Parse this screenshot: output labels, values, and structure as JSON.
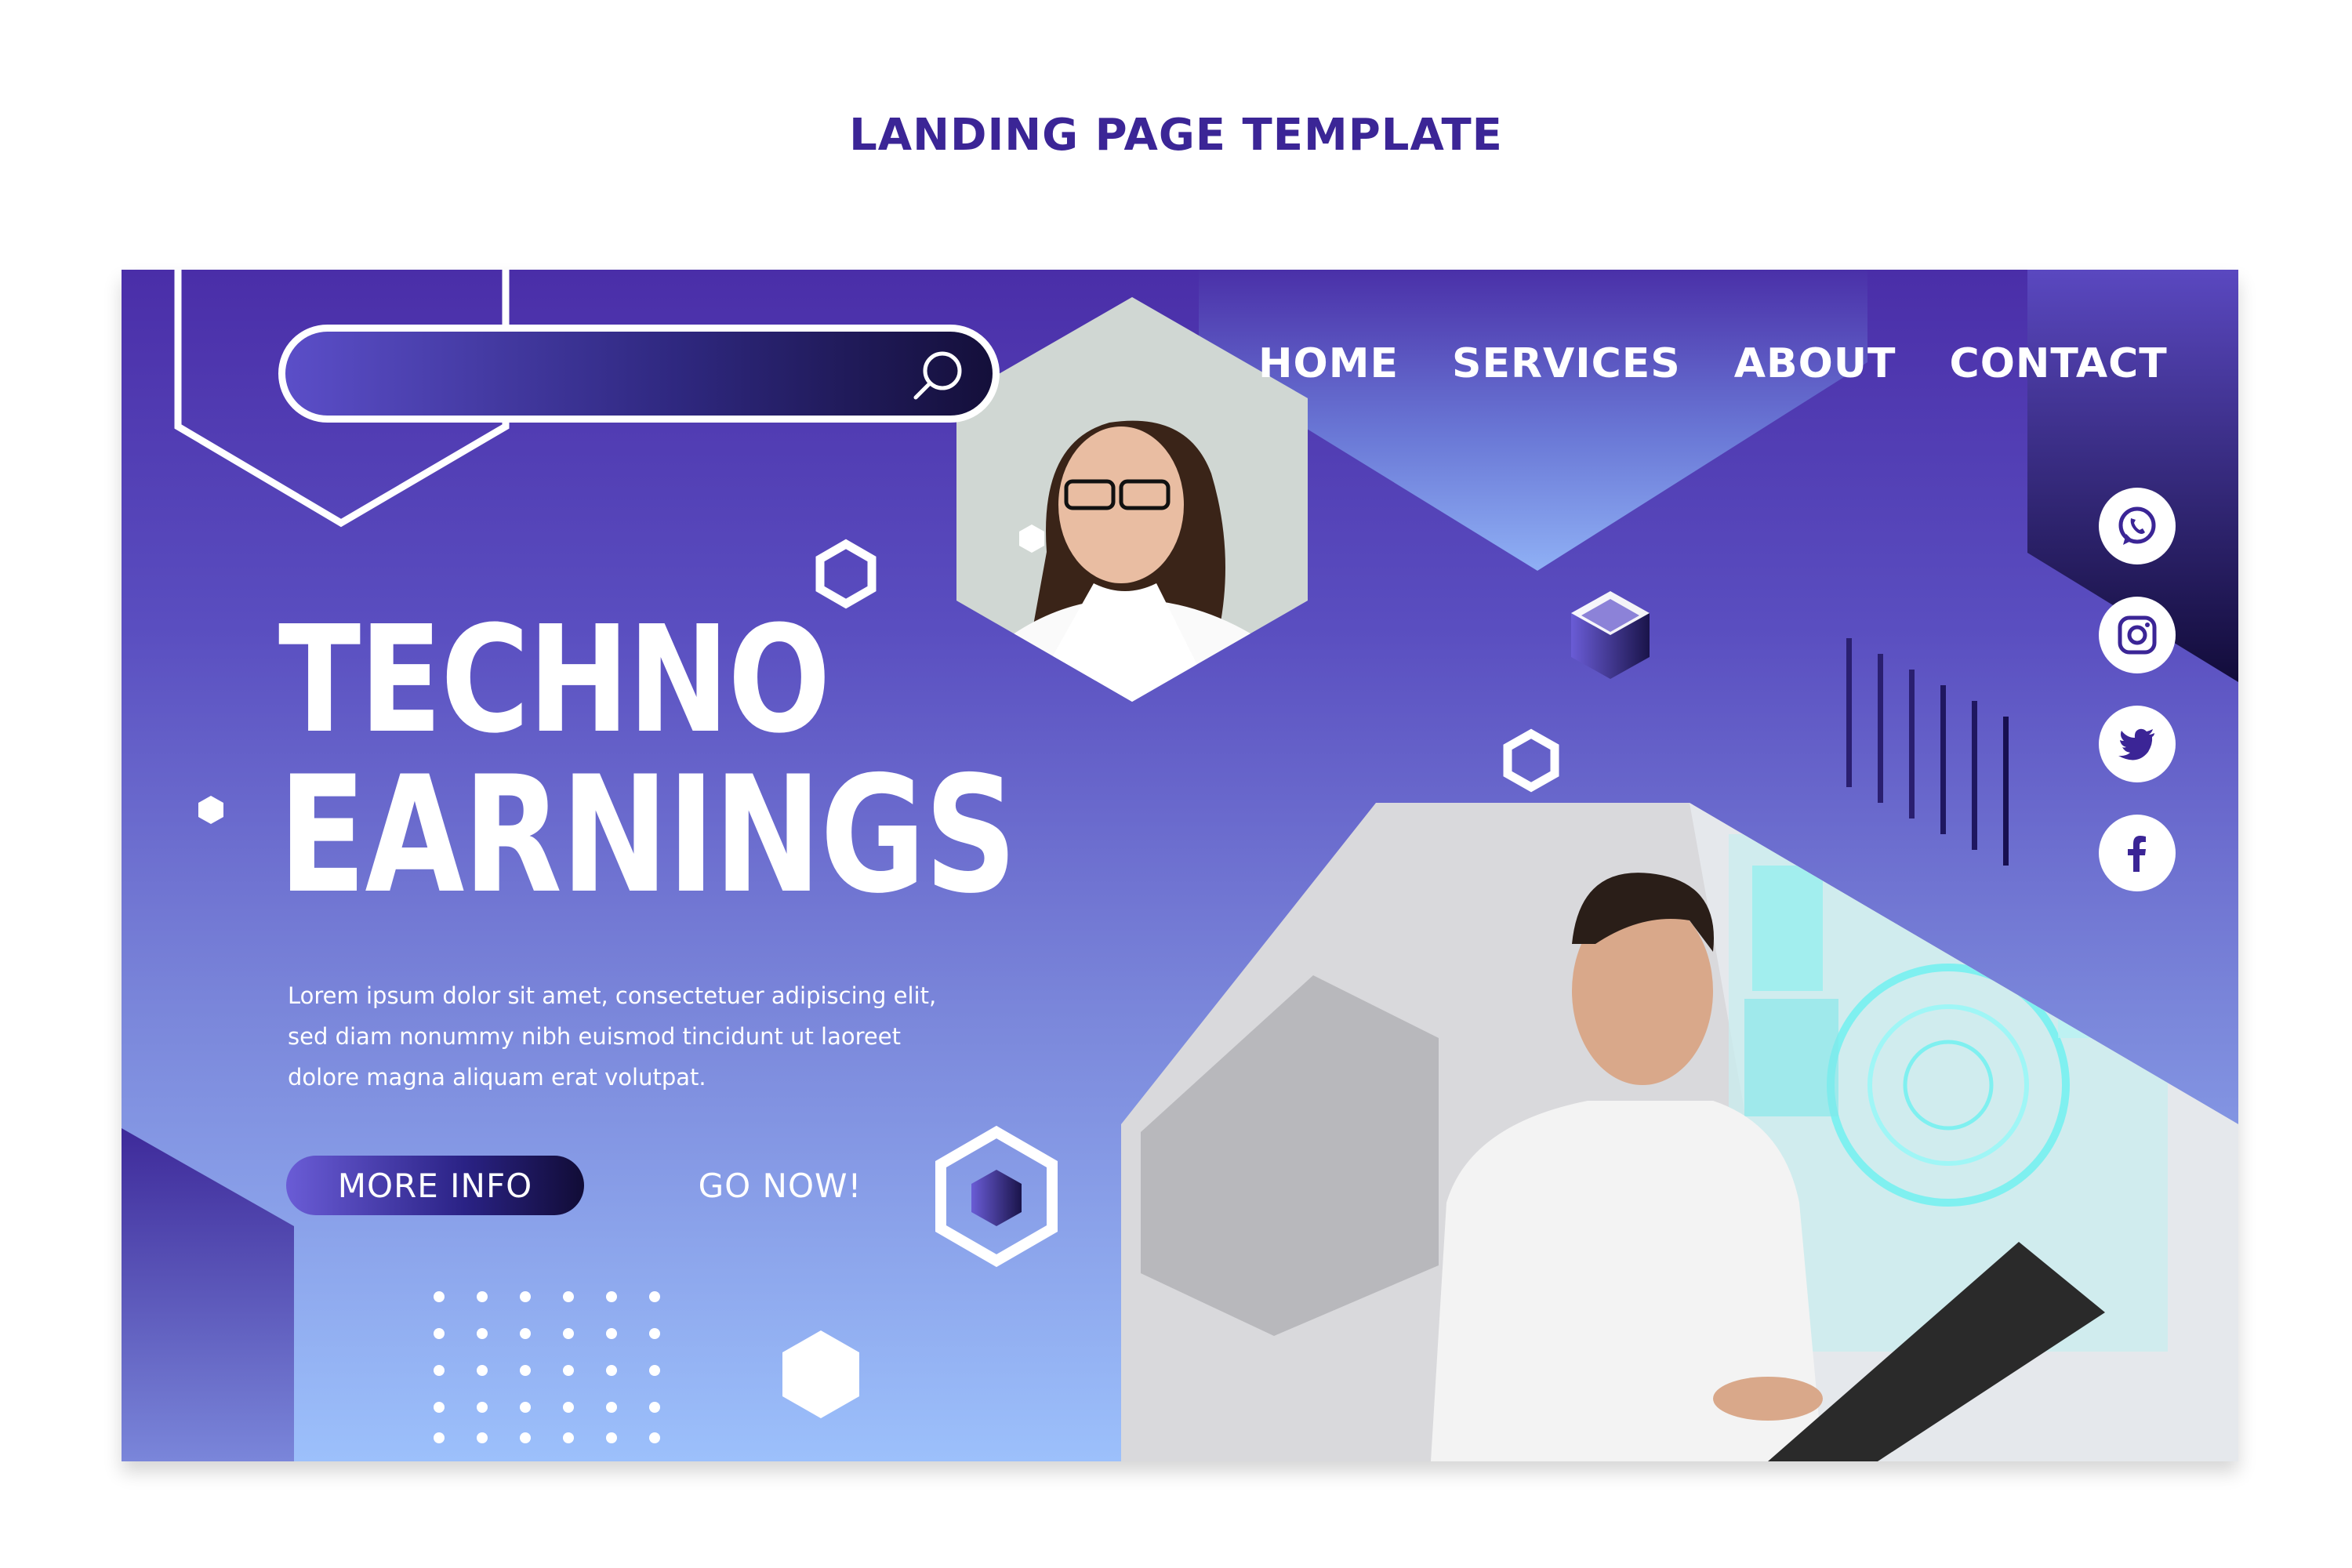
{
  "page": {
    "title": "LANDING PAGE TEMPLATE"
  },
  "search": {
    "placeholder": "",
    "value": ""
  },
  "nav": {
    "items": [
      "HOME",
      "SERVICES",
      "ABOUT",
      "CONTACT"
    ]
  },
  "hero": {
    "headline_line1": "TECHNO",
    "headline_line2": "EARNINGS",
    "body": "Lorem ipsum dolor sit amet, consectetuer adipiscing elit, sed diam nonummy nibh euismod tincidunt ut laoreet dolore magna aliquam erat volutpat.",
    "primary_button": "MORE INFO",
    "secondary_button": "GO NOW!"
  },
  "social": [
    "whatsapp-icon",
    "instagram-icon",
    "twitter-icon",
    "facebook-icon"
  ],
  "colors": {
    "title": "#3b2596",
    "gradient_top": "#4a2ea8",
    "gradient_bottom": "#9cc0fb",
    "accent_dark": "#140f3a",
    "social_icon": "#3b2596",
    "hud_glow": "#7ff0f0"
  }
}
